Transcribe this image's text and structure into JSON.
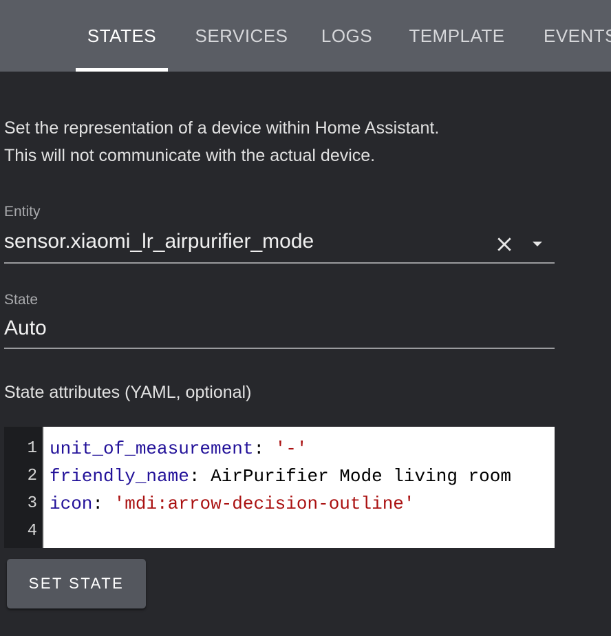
{
  "tabs": [
    {
      "label": "STATES",
      "active": true
    },
    {
      "label": "SERVICES",
      "active": false
    },
    {
      "label": "LOGS",
      "active": false
    },
    {
      "label": "TEMPLATE",
      "active": false
    },
    {
      "label": "EVENTS",
      "active": false
    }
  ],
  "description": {
    "line1": "Set the representation of a device within Home Assistant.",
    "line2": "This will not communicate with the actual device."
  },
  "entity": {
    "label": "Entity",
    "value": "sensor.xiaomi_lr_airpurifier_mode",
    "clear_icon": "close-icon",
    "dropdown_icon": "menu-down-icon"
  },
  "state": {
    "label": "State",
    "value": "Auto"
  },
  "attributes": {
    "label": "State attributes (YAML, optional)",
    "line_numbers": [
      "1",
      "2",
      "3",
      "4"
    ],
    "lines": [
      {
        "key": "unit_of_measurement",
        "sep": ": ",
        "value": "'-'",
        "value_type": "string"
      },
      {
        "key": "friendly_name",
        "sep": ": ",
        "value": "AirPurifier Mode living room",
        "value_type": "plain"
      },
      {
        "key": "icon",
        "sep": ": ",
        "value": "'mdi:arrow-decision-outline'",
        "value_type": "string"
      },
      {
        "key": "",
        "sep": "",
        "value": "",
        "value_type": "plain"
      }
    ]
  },
  "set_state_button": {
    "label": "SET STATE"
  },
  "colors": {
    "background": "#27282c",
    "tabbar": "#5a5d64",
    "yaml_key": "#221199",
    "yaml_string": "#aa1111",
    "button": "#54575e"
  }
}
